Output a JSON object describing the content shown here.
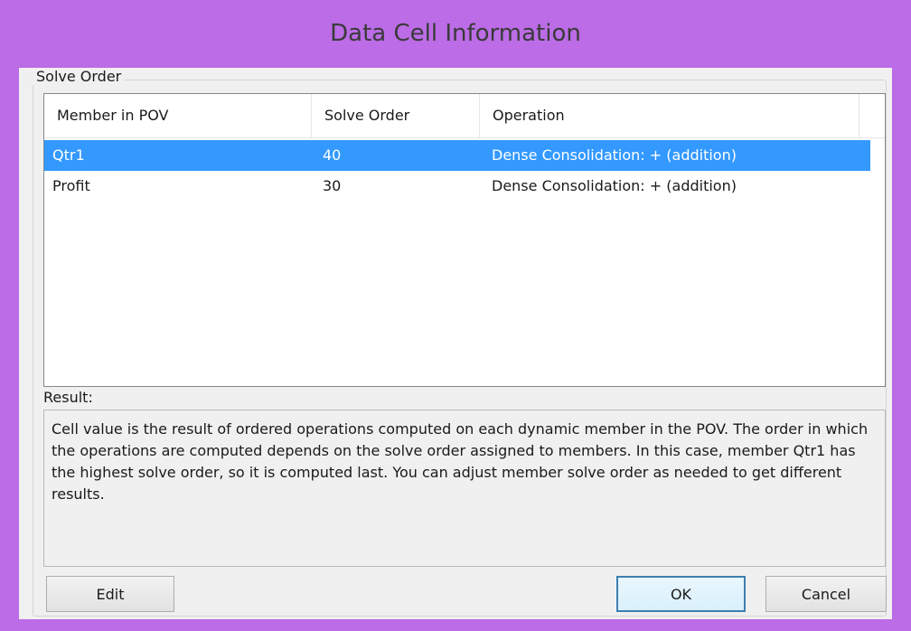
{
  "window": {
    "title": "Data Cell Information"
  },
  "group": {
    "legend": "Solve Order"
  },
  "table": {
    "headers": [
      "Member in POV",
      "Solve Order",
      "Operation"
    ],
    "rows": [
      {
        "member": "Qtr1",
        "solve_order": "40",
        "operation": "Dense Consolidation: + (addition)",
        "selected": true
      },
      {
        "member": "Profit",
        "solve_order": "30",
        "operation": "Dense Consolidation: + (addition)",
        "selected": false
      }
    ]
  },
  "result": {
    "label": "Result:",
    "text": "Cell value is the result of ordered operations computed on each dynamic member in the POV. The order in which the operations are computed depends on the solve order assigned to members. In this case, member Qtr1 has the highest solve order, so it is computed last. You can adjust member solve order as needed to get different results."
  },
  "buttons": {
    "edit": "Edit",
    "ok": "OK",
    "cancel": "Cancel"
  },
  "colors": {
    "frame": "#bb6ce6",
    "selection": "#3399ff"
  }
}
